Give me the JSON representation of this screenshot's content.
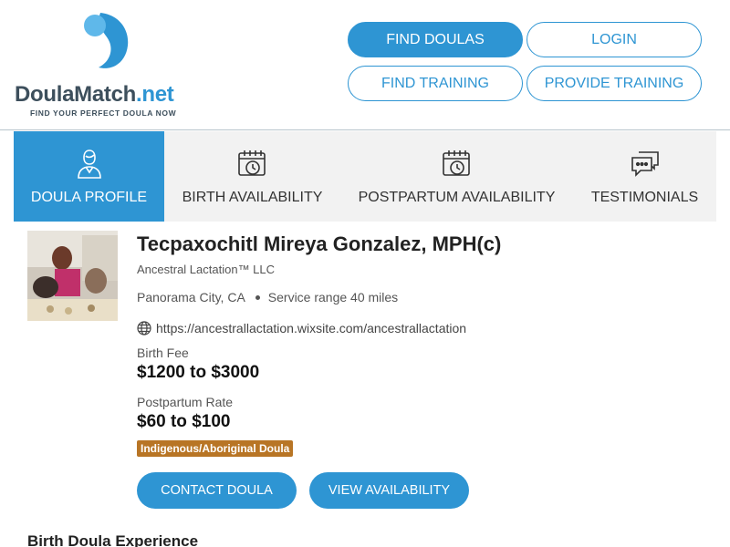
{
  "brand": {
    "name_main": "DoulaMatch",
    "name_dot": ".net",
    "tagline": "FIND YOUR PERFECT DOULA NOW",
    "color_primary": "#2e95d3",
    "color_text": "#3d4f5c",
    "icon": "logo-drop-icon"
  },
  "nav": {
    "find_doulas": "FIND DOULAS",
    "login": "LOGIN",
    "find_training": "FIND TRAINING",
    "provide_training": "PROVIDE TRAINING"
  },
  "tabs": [
    {
      "label": "DOULA PROFILE",
      "icon": "doula-person-icon",
      "active": true
    },
    {
      "label": "BIRTH AVAILABILITY",
      "icon": "calendar-clock-icon",
      "active": false
    },
    {
      "label": "POSTPARTUM AVAILABILITY",
      "icon": "calendar-clock-icon",
      "active": false
    },
    {
      "label": "TESTIMONIALS",
      "icon": "chat-bubbles-icon",
      "active": false
    }
  ],
  "profile": {
    "name": "Tecpaxochitl Mireya Gonzalez, MPH(c)",
    "company": "Ancestral Lactation™ LLC",
    "city": "Panorama City, CA",
    "service_range": "Service range 40 miles",
    "website": "https://ancestrallactation.wixsite.com/ancestrallactation",
    "birth_fee_label": "Birth Fee",
    "birth_fee": "$1200 to $3000",
    "postpartum_label": "Postpartum Rate",
    "postpartum_rate": "$60 to $100",
    "badge": "Indigenous/Aboriginal Doula",
    "badge_color": "#b87525"
  },
  "actions": {
    "contact": "CONTACT DOULA",
    "availability": "VIEW AVAILABILITY"
  },
  "section": {
    "heading": "Birth Doula Experience"
  }
}
